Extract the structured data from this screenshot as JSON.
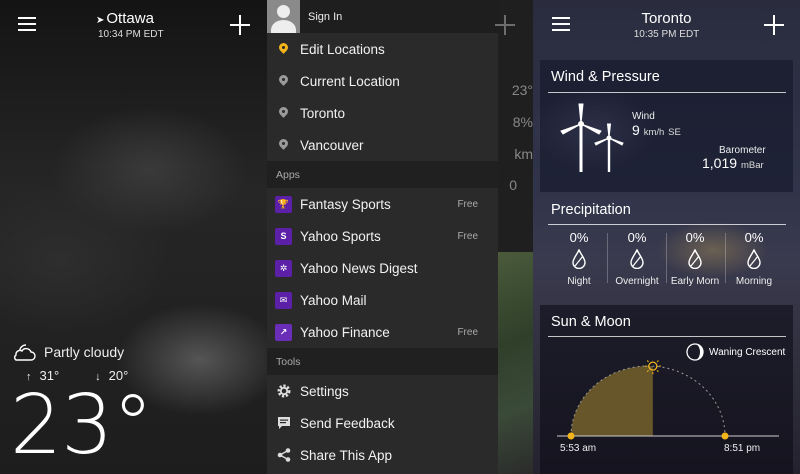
{
  "panel_left": {
    "city": "Ottawa",
    "time": "10:34 PM EDT",
    "condition": "Partly cloudy",
    "high": "31°",
    "low": "20°",
    "temperature": "23°"
  },
  "menu": {
    "sign_in": "Sign In",
    "locations": [
      {
        "label": "Edit Locations",
        "icon": "location-pin-icon",
        "color": "#f2b51b"
      },
      {
        "label": "Current Location",
        "icon": "location-pin-icon",
        "color": "#9a9a9a"
      },
      {
        "label": "Toronto",
        "icon": "location-pin-icon",
        "color": "#9a9a9a"
      },
      {
        "label": "Vancouver",
        "icon": "location-pin-icon",
        "color": "#9a9a9a"
      }
    ],
    "apps_header": "Apps",
    "apps": [
      {
        "label": "Fantasy Sports",
        "tag": "Free",
        "icon": "fantasy-sports-icon"
      },
      {
        "label": "Yahoo Sports",
        "tag": "Free",
        "icon": "yahoo-sports-icon"
      },
      {
        "label": "Yahoo News Digest",
        "tag": "",
        "icon": "news-digest-icon"
      },
      {
        "label": "Yahoo Mail",
        "tag": "",
        "icon": "mail-icon"
      },
      {
        "label": "Yahoo Finance",
        "tag": "Free",
        "icon": "finance-icon"
      }
    ],
    "tools_header": "Tools",
    "tools": [
      {
        "label": "Settings",
        "icon": "gear-icon"
      },
      {
        "label": "Send Feedback",
        "icon": "feedback-icon"
      },
      {
        "label": "Share This App",
        "icon": "share-icon"
      }
    ],
    "peek_values": [
      "23°",
      "8%",
      "km",
      "0"
    ]
  },
  "panel_right": {
    "city": "Toronto",
    "time": "10:35 PM EDT",
    "wind_pressure": {
      "title": "Wind & Pressure",
      "wind_label": "Wind",
      "wind_value": "9",
      "wind_unit": "km/h",
      "wind_dir": "SE",
      "baro_label": "Barometer",
      "baro_value": "1,019",
      "baro_unit": "mBar"
    },
    "precipitation": {
      "title": "Precipitation",
      "periods": [
        {
          "pct": "0%",
          "name": "Night"
        },
        {
          "pct": "0%",
          "name": "Overnight"
        },
        {
          "pct": "0%",
          "name": "Early Morn"
        },
        {
          "pct": "0%",
          "name": "Morning"
        }
      ]
    },
    "sun_moon": {
      "title": "Sun & Moon",
      "moon_phase": "Waning Crescent",
      "sunrise": "5:53 am",
      "sunset": "8:51 pm",
      "day_progress": 0.52
    }
  },
  "colors": {
    "accent_yellow": "#f2b51b",
    "yahoo_purple": "#5b1fa8",
    "sun_fill": "#6b5a2a"
  }
}
